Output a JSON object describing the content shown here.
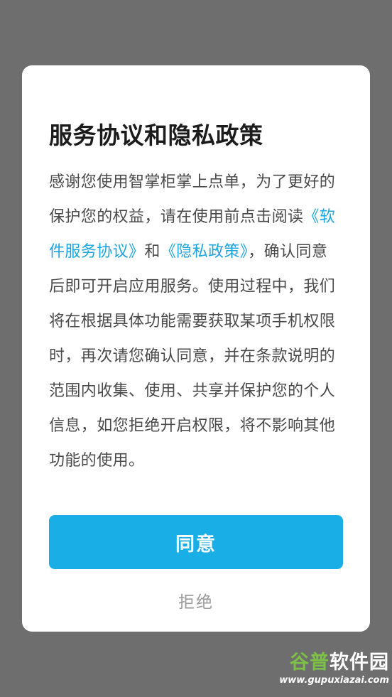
{
  "dialog": {
    "title": "服务协议和隐私政策",
    "body": {
      "line1": "感谢您使用智掌柜掌上点单，为了更好的",
      "line2_pre": "保护您的权益，请在使用前点击阅读",
      "line2_link": "《软",
      "line3_link1": "件服务协议》",
      "line3_mid": "和",
      "line3_link2": "《隐私政策》",
      "line3_post": "，确认同意",
      "line4": "后即可开启应用服务。使用过程中，我们",
      "line5": "将在根据具体功能需要获取某项手机权限",
      "line6": "时，再次请您确认同意，并在条款说明的",
      "line7": "范围内收集、使用、共享并保护您的个人",
      "line8": "信息，如您拒绝开启权限，将不影响其他",
      "line9": "功能的使用。"
    },
    "agree_label": "同意",
    "reject_label": "拒绝"
  },
  "watermark": {
    "brand_green": "谷普",
    "brand_white": "软件园",
    "url": "www.gupuxiazai.com"
  },
  "colors": {
    "accent": "#1aaee6",
    "link": "#1ba6e0",
    "overlay": "#6e6e6e",
    "watermark_green": "#7cc046"
  }
}
